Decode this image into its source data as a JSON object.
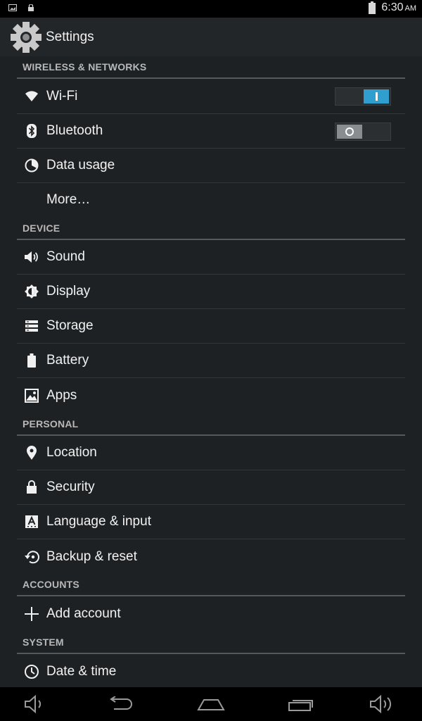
{
  "status_bar": {
    "time": "6:30",
    "ampm": "AM",
    "icons": [
      "screenshot-icon",
      "lock-icon",
      "battery-icon"
    ]
  },
  "action_bar": {
    "title": "Settings",
    "icon": "settings-gear-icon"
  },
  "sections": {
    "wireless": "WIRELESS & NETWORKS",
    "device": "DEVICE",
    "personal": "PERSONAL",
    "accounts": "ACCOUNTS",
    "system": "SYSTEM"
  },
  "items": {
    "wifi": {
      "label": "Wi-Fi",
      "icon": "wifi-icon",
      "toggle": "on"
    },
    "bluetooth": {
      "label": "Bluetooth",
      "icon": "bluetooth-icon",
      "toggle": "off"
    },
    "data_usage": {
      "label": "Data usage",
      "icon": "data-usage-icon"
    },
    "more": {
      "label": "More…"
    },
    "sound": {
      "label": "Sound",
      "icon": "speaker-icon"
    },
    "display": {
      "label": "Display",
      "icon": "brightness-icon"
    },
    "storage": {
      "label": "Storage",
      "icon": "storage-icon"
    },
    "battery": {
      "label": "Battery",
      "icon": "battery-icon"
    },
    "apps": {
      "label": "Apps",
      "icon": "apps-icon"
    },
    "location": {
      "label": "Location",
      "icon": "location-pin-icon"
    },
    "security": {
      "label": "Security",
      "icon": "lock-icon"
    },
    "language": {
      "label": "Language & input",
      "icon": "keyboard-a-icon"
    },
    "backup": {
      "label": "Backup & reset",
      "icon": "backup-icon"
    },
    "add_account": {
      "label": "Add account",
      "icon": "plus-icon"
    },
    "date_time": {
      "label": "Date & time",
      "icon": "clock-icon"
    }
  },
  "nav_bar": {
    "buttons": [
      "volume-down-icon",
      "back-icon",
      "home-icon",
      "recents-icon",
      "volume-up-icon"
    ]
  },
  "colors": {
    "accent": "#2f9fcf",
    "background": "#1e2124",
    "action_bar": "#232628"
  }
}
